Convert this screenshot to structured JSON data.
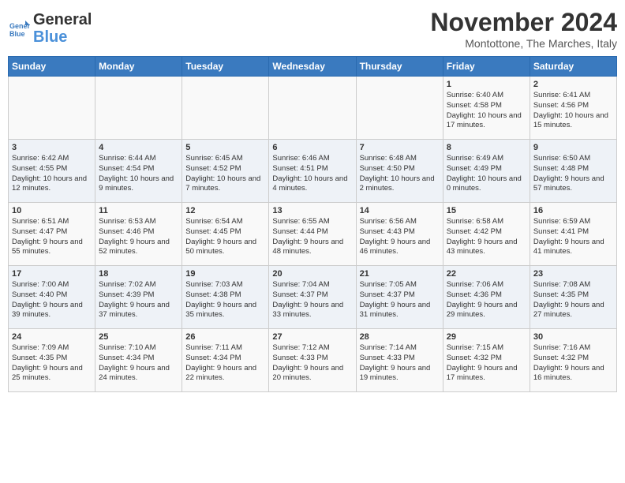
{
  "header": {
    "logo_text_general": "General",
    "logo_text_blue": "Blue",
    "month_title": "November 2024",
    "subtitle": "Montottone, The Marches, Italy"
  },
  "days_of_week": [
    "Sunday",
    "Monday",
    "Tuesday",
    "Wednesday",
    "Thursday",
    "Friday",
    "Saturday"
  ],
  "weeks": [
    [
      {
        "day": "",
        "info": ""
      },
      {
        "day": "",
        "info": ""
      },
      {
        "day": "",
        "info": ""
      },
      {
        "day": "",
        "info": ""
      },
      {
        "day": "",
        "info": ""
      },
      {
        "day": "1",
        "info": "Sunrise: 6:40 AM\nSunset: 4:58 PM\nDaylight: 10 hours and 17 minutes."
      },
      {
        "day": "2",
        "info": "Sunrise: 6:41 AM\nSunset: 4:56 PM\nDaylight: 10 hours and 15 minutes."
      }
    ],
    [
      {
        "day": "3",
        "info": "Sunrise: 6:42 AM\nSunset: 4:55 PM\nDaylight: 10 hours and 12 minutes."
      },
      {
        "day": "4",
        "info": "Sunrise: 6:44 AM\nSunset: 4:54 PM\nDaylight: 10 hours and 9 minutes."
      },
      {
        "day": "5",
        "info": "Sunrise: 6:45 AM\nSunset: 4:52 PM\nDaylight: 10 hours and 7 minutes."
      },
      {
        "day": "6",
        "info": "Sunrise: 6:46 AM\nSunset: 4:51 PM\nDaylight: 10 hours and 4 minutes."
      },
      {
        "day": "7",
        "info": "Sunrise: 6:48 AM\nSunset: 4:50 PM\nDaylight: 10 hours and 2 minutes."
      },
      {
        "day": "8",
        "info": "Sunrise: 6:49 AM\nSunset: 4:49 PM\nDaylight: 10 hours and 0 minutes."
      },
      {
        "day": "9",
        "info": "Sunrise: 6:50 AM\nSunset: 4:48 PM\nDaylight: 9 hours and 57 minutes."
      }
    ],
    [
      {
        "day": "10",
        "info": "Sunrise: 6:51 AM\nSunset: 4:47 PM\nDaylight: 9 hours and 55 minutes."
      },
      {
        "day": "11",
        "info": "Sunrise: 6:53 AM\nSunset: 4:46 PM\nDaylight: 9 hours and 52 minutes."
      },
      {
        "day": "12",
        "info": "Sunrise: 6:54 AM\nSunset: 4:45 PM\nDaylight: 9 hours and 50 minutes."
      },
      {
        "day": "13",
        "info": "Sunrise: 6:55 AM\nSunset: 4:44 PM\nDaylight: 9 hours and 48 minutes."
      },
      {
        "day": "14",
        "info": "Sunrise: 6:56 AM\nSunset: 4:43 PM\nDaylight: 9 hours and 46 minutes."
      },
      {
        "day": "15",
        "info": "Sunrise: 6:58 AM\nSunset: 4:42 PM\nDaylight: 9 hours and 43 minutes."
      },
      {
        "day": "16",
        "info": "Sunrise: 6:59 AM\nSunset: 4:41 PM\nDaylight: 9 hours and 41 minutes."
      }
    ],
    [
      {
        "day": "17",
        "info": "Sunrise: 7:00 AM\nSunset: 4:40 PM\nDaylight: 9 hours and 39 minutes."
      },
      {
        "day": "18",
        "info": "Sunrise: 7:02 AM\nSunset: 4:39 PM\nDaylight: 9 hours and 37 minutes."
      },
      {
        "day": "19",
        "info": "Sunrise: 7:03 AM\nSunset: 4:38 PM\nDaylight: 9 hours and 35 minutes."
      },
      {
        "day": "20",
        "info": "Sunrise: 7:04 AM\nSunset: 4:37 PM\nDaylight: 9 hours and 33 minutes."
      },
      {
        "day": "21",
        "info": "Sunrise: 7:05 AM\nSunset: 4:37 PM\nDaylight: 9 hours and 31 minutes."
      },
      {
        "day": "22",
        "info": "Sunrise: 7:06 AM\nSunset: 4:36 PM\nDaylight: 9 hours and 29 minutes."
      },
      {
        "day": "23",
        "info": "Sunrise: 7:08 AM\nSunset: 4:35 PM\nDaylight: 9 hours and 27 minutes."
      }
    ],
    [
      {
        "day": "24",
        "info": "Sunrise: 7:09 AM\nSunset: 4:35 PM\nDaylight: 9 hours and 25 minutes."
      },
      {
        "day": "25",
        "info": "Sunrise: 7:10 AM\nSunset: 4:34 PM\nDaylight: 9 hours and 24 minutes."
      },
      {
        "day": "26",
        "info": "Sunrise: 7:11 AM\nSunset: 4:34 PM\nDaylight: 9 hours and 22 minutes."
      },
      {
        "day": "27",
        "info": "Sunrise: 7:12 AM\nSunset: 4:33 PM\nDaylight: 9 hours and 20 minutes."
      },
      {
        "day": "28",
        "info": "Sunrise: 7:14 AM\nSunset: 4:33 PM\nDaylight: 9 hours and 19 minutes."
      },
      {
        "day": "29",
        "info": "Sunrise: 7:15 AM\nSunset: 4:32 PM\nDaylight: 9 hours and 17 minutes."
      },
      {
        "day": "30",
        "info": "Sunrise: 7:16 AM\nSunset: 4:32 PM\nDaylight: 9 hours and 16 minutes."
      }
    ]
  ]
}
